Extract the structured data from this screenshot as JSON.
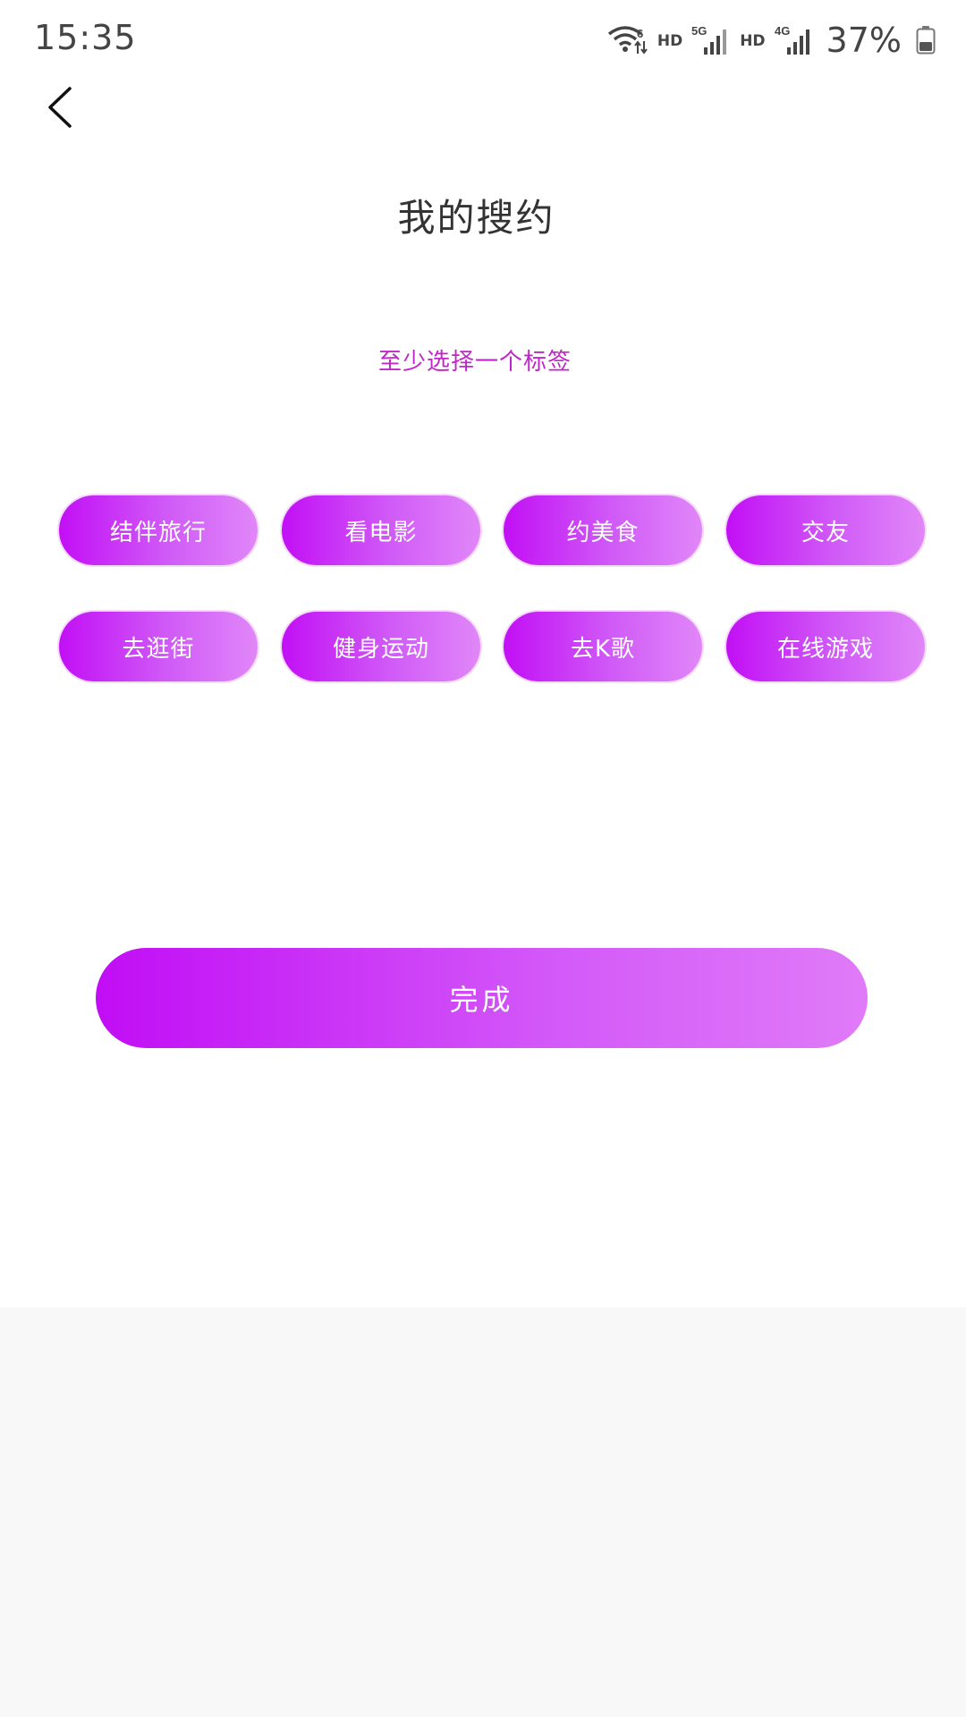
{
  "status_bar": {
    "time": "15:35",
    "wifi_badge": "6",
    "hd1": "HD",
    "net1": "5G",
    "hd2": "HD",
    "net2": "4G",
    "battery": "37%"
  },
  "header": {
    "title": "我的搜约"
  },
  "hint": "至少选择一个标签",
  "tags": [
    {
      "label": "结伴旅行"
    },
    {
      "label": "看电影"
    },
    {
      "label": "约美食"
    },
    {
      "label": "交友"
    },
    {
      "label": "去逛街"
    },
    {
      "label": "健身运动"
    },
    {
      "label": "去K歌"
    },
    {
      "label": "在线游戏"
    }
  ],
  "finish_label": "完成",
  "colors": {
    "accent_start": "#c20ff5",
    "accent_end": "#e187f8",
    "hint": "#c026c9"
  }
}
